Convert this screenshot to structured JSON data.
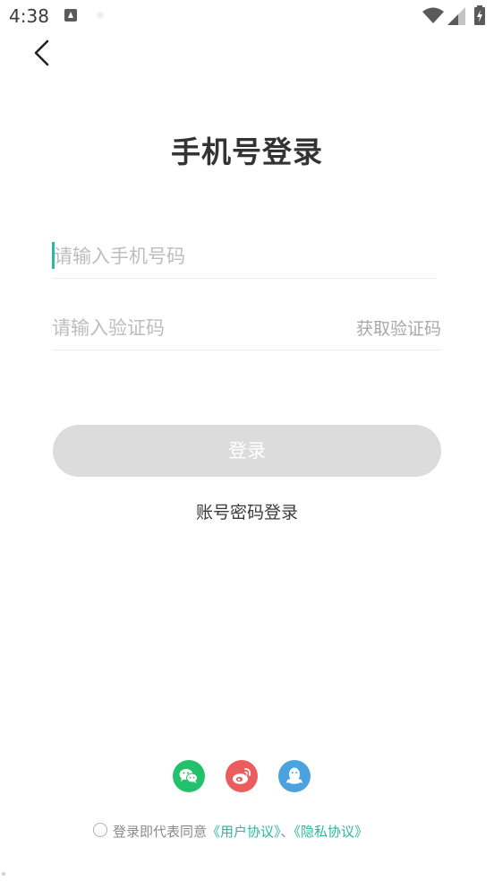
{
  "status_bar": {
    "time": "4:38"
  },
  "header": {
    "title": "手机号登录"
  },
  "form": {
    "phone_placeholder": "请输入手机号码",
    "phone_value": "",
    "code_placeholder": "请输入验证码",
    "code_value": "",
    "get_code_label": "获取验证码",
    "login_label": "登录",
    "account_login_label": "账号密码登录"
  },
  "social": [
    "wechat-icon",
    "weibo-icon",
    "qq-icon"
  ],
  "agreement": {
    "prefix": "登录即代表同意",
    "user_agreement": "《用户协议》",
    "separator": "、",
    "privacy_agreement": "《隐私协议》"
  },
  "colors": {
    "accent": "#2bb7a3",
    "button_disabled": "#dcdcdc",
    "wechat": "#23c16b",
    "weibo": "#ea5d5c",
    "qq": "#4aa3de"
  }
}
